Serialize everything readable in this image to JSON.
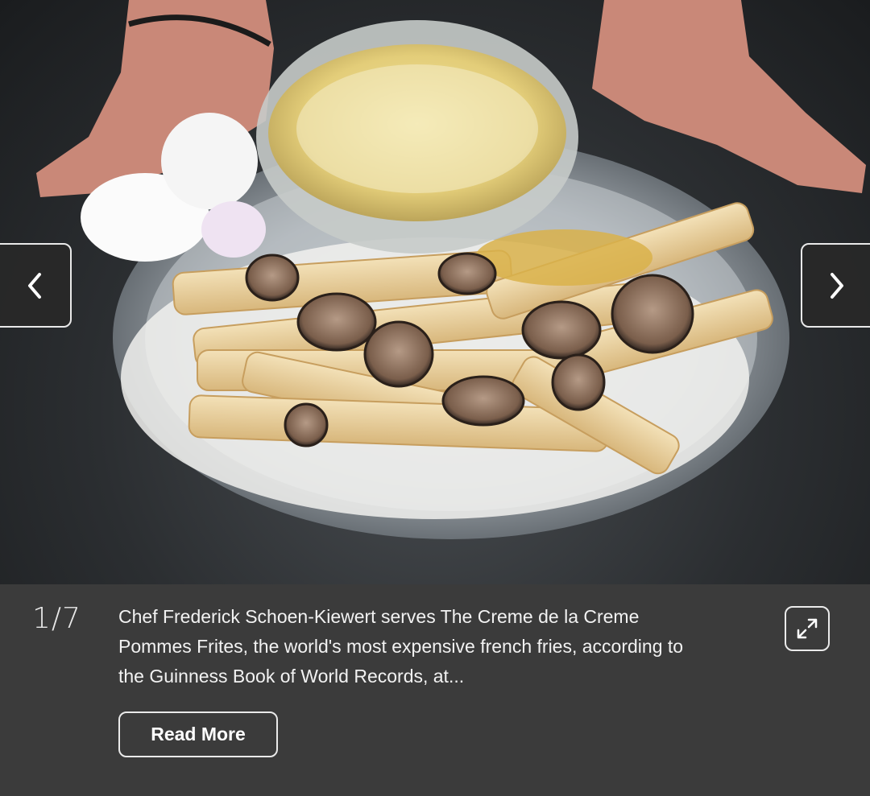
{
  "photo": {
    "alt_subject": "french fries with truffles and gold leaf"
  },
  "navigation": {
    "prev_icon": "chevron-left-icon",
    "next_icon": "chevron-right-icon"
  },
  "caption": {
    "counter": "1/7",
    "text": "Chef Frederick Schoen-Kiewert serves The Creme de la Creme Pommes Frites, the world's most expensive french fries, according to the Guinness Book of World Records, at...",
    "expand_icon": "expand-icon",
    "read_more_label": "Read More"
  },
  "colors": {
    "panel_bg": "#3b3b3b",
    "text": "#f2f2f2",
    "border": "#eaeaea"
  }
}
